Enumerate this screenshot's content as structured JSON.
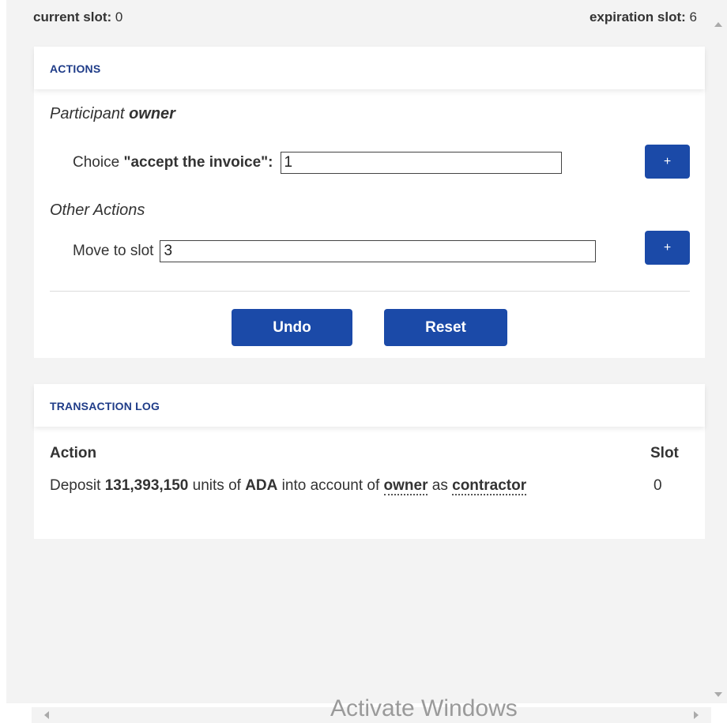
{
  "slots": {
    "current_label": "current slot:",
    "current_value": "0",
    "expiration_label": "expiration slot:",
    "expiration_value": "6"
  },
  "actions": {
    "header": "ACTIONS",
    "participant_prefix": "Participant",
    "participant_name": "owner",
    "choice_prefix": "Choice",
    "choice_name": "\"accept the invoice\":",
    "choice_value": "1",
    "plus_label": "+",
    "other_actions_label": "Other Actions",
    "move_label": "Move to slot",
    "move_value": "3",
    "undo_label": "Undo",
    "reset_label": "Reset"
  },
  "transaction_log": {
    "header": "TRANSACTION LOG",
    "col_action": "Action",
    "col_slot": "Slot",
    "rows": [
      {
        "deposit_word": "Deposit",
        "amount": "131,393,150",
        "units_of": "units of",
        "token": "ADA",
        "into_account_of": "into account of",
        "account": "owner",
        "as_word": "as",
        "party": "contractor",
        "slot": "0"
      }
    ]
  },
  "watermark": "Activate Windows",
  "colors": {
    "accent": "#1b4aa8",
    "header_text": "#1f3c88",
    "background": "#f3f3f3"
  }
}
